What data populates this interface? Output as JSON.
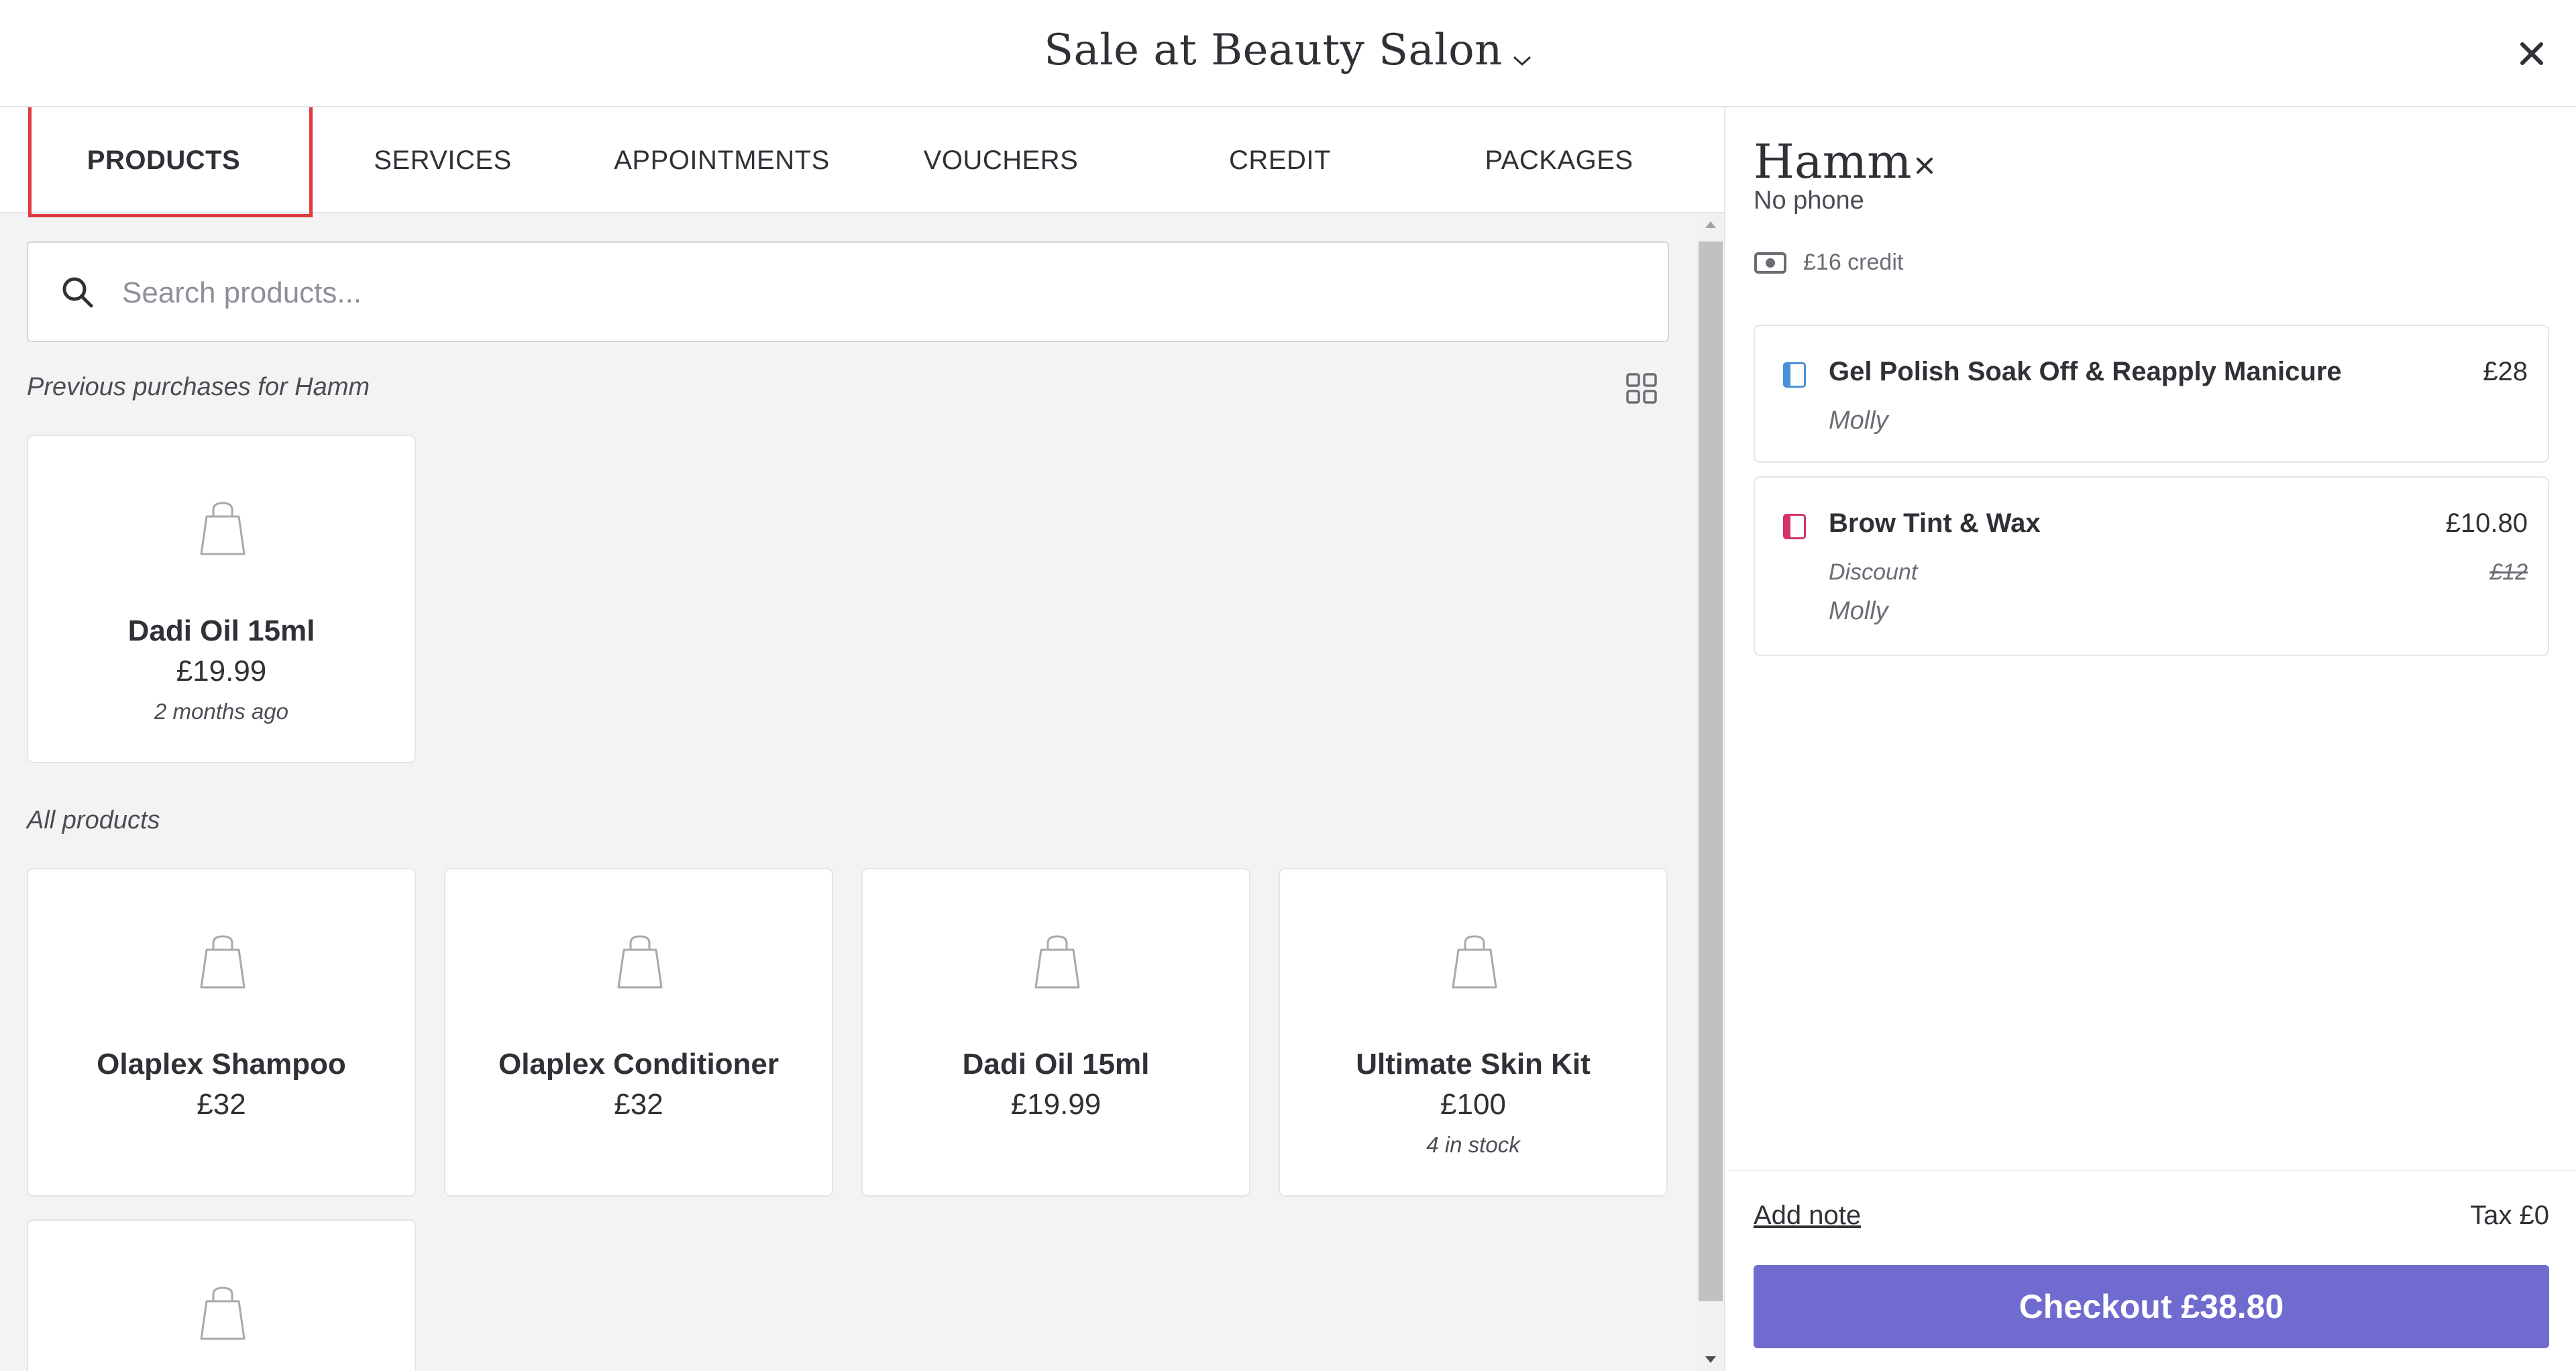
{
  "header": {
    "title": "Sale at Beauty Salon",
    "title_icon": "chevron-down-icon",
    "close_icon": "close-icon"
  },
  "tabs": [
    {
      "label": "PRODUCTS",
      "active": true
    },
    {
      "label": "SERVICES",
      "active": false
    },
    {
      "label": "APPOINTMENTS",
      "active": false
    },
    {
      "label": "VOUCHERS",
      "active": false
    },
    {
      "label": "CREDIT",
      "active": false
    },
    {
      "label": "PACKAGES",
      "active": false
    }
  ],
  "search": {
    "placeholder": "Search products...",
    "value": ""
  },
  "previous": {
    "label": "Previous purchases for Hamm",
    "items": [
      {
        "name": "Dadi Oil 15ml",
        "price": "£19.99",
        "meta": "2 months ago"
      }
    ]
  },
  "all_products": {
    "label": "All products",
    "items": [
      {
        "name": "Olaplex Shampoo",
        "price": "£32",
        "meta": ""
      },
      {
        "name": "Olaplex Conditioner",
        "price": "£32",
        "meta": ""
      },
      {
        "name": "Dadi Oil 15ml",
        "price": "£19.99",
        "meta": ""
      },
      {
        "name": "Ultimate Skin Kit",
        "price": "£100",
        "meta": "4 in stock"
      },
      {
        "name": "",
        "price": "",
        "meta": ""
      }
    ]
  },
  "client": {
    "name": "Hamm",
    "phone": "No phone",
    "credit": "£16 credit"
  },
  "cart": {
    "items": [
      {
        "title": "Gel Polish Soak Off & Reapply Manicure",
        "amount": "£28",
        "staff": "Molly",
        "marker_color": "#4a90d9",
        "discount_label": "",
        "original_price": ""
      },
      {
        "title": "Brow Tint & Wax",
        "amount": "£10.80",
        "staff": "Molly",
        "marker_color": "#d6336c",
        "discount_label": "Discount",
        "original_price": "£12"
      }
    ],
    "add_note": "Add note",
    "tax": "Tax £0",
    "checkout": "Checkout £38.80"
  },
  "colors": {
    "accent": "#6f6bcf",
    "highlight": "#e0393e"
  }
}
